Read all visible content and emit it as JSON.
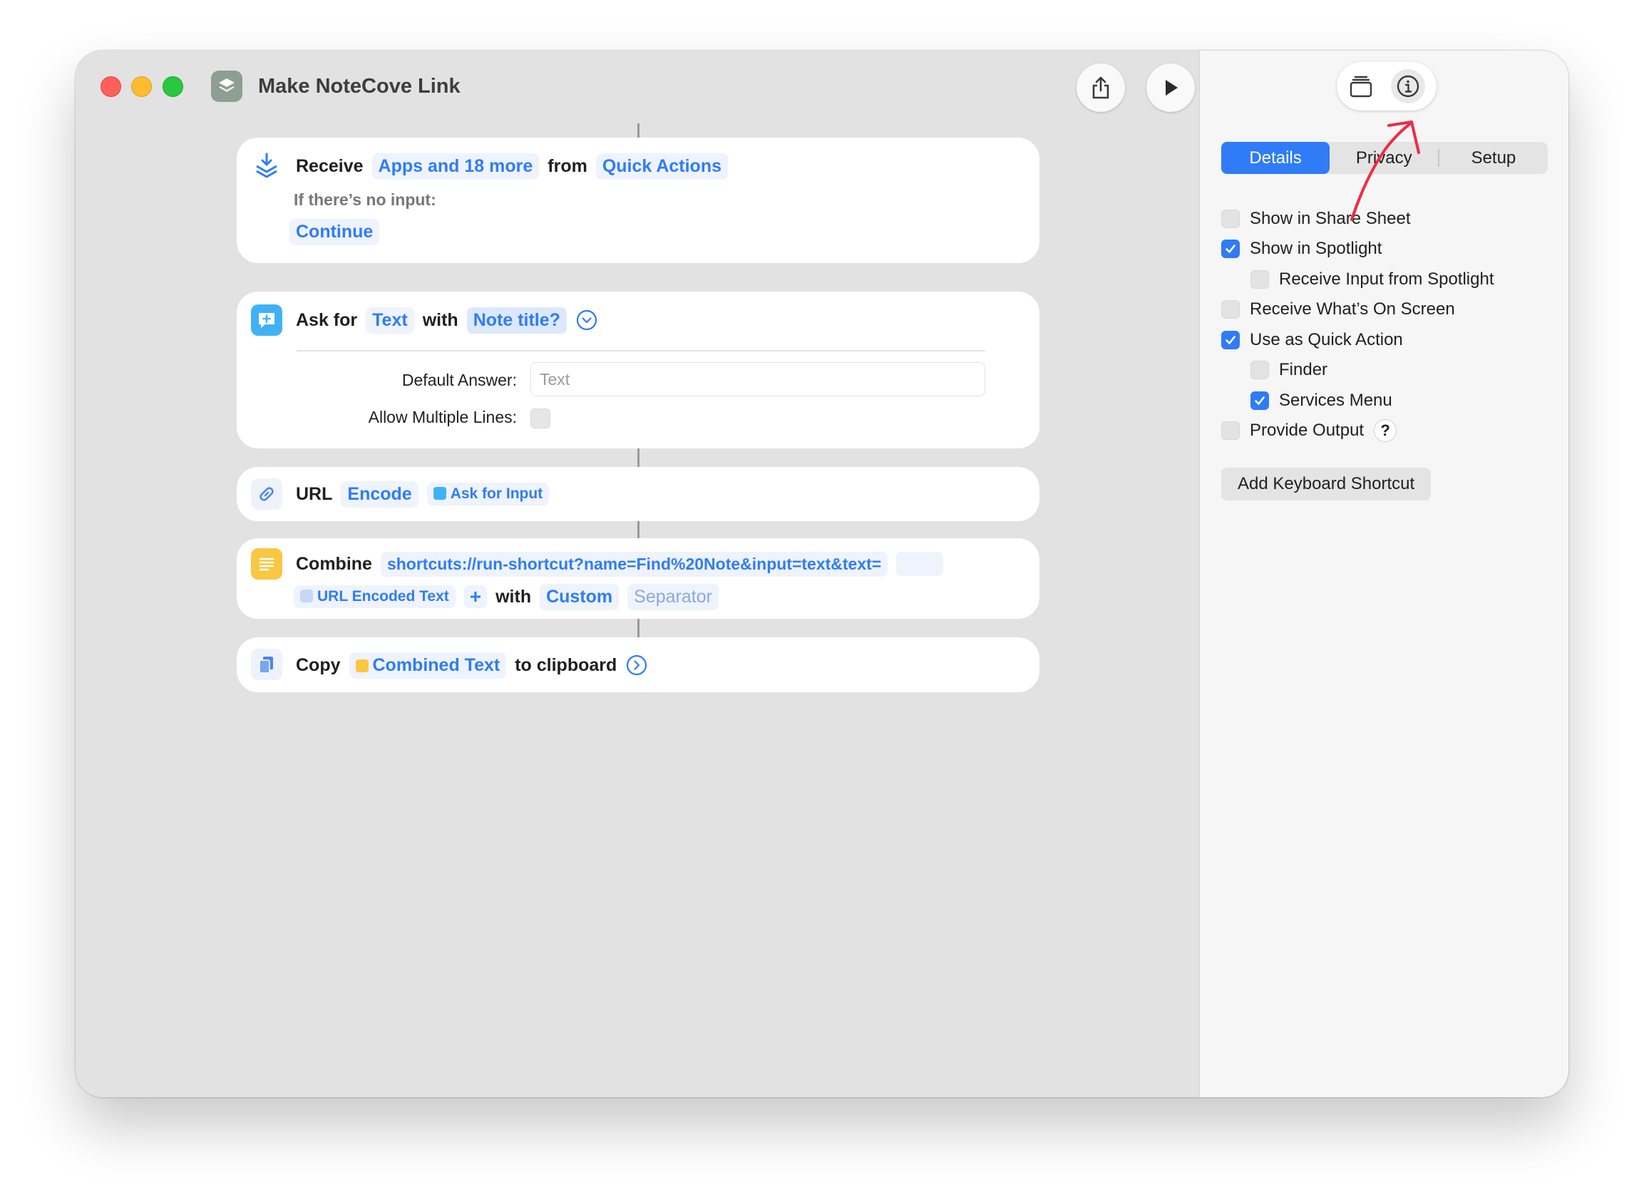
{
  "window": {
    "title": "Make NoteCove Link"
  },
  "toolbar": {
    "share_icon": "share-icon",
    "run_icon": "play-icon"
  },
  "actions": {
    "receive": {
      "label": "Receive",
      "types": "Apps and 18 more",
      "from_label": "from",
      "source": "Quick Actions",
      "no_input_label": "If there’s no input:",
      "no_input_action": "Continue"
    },
    "ask": {
      "label": "Ask for",
      "type": "Text",
      "with_label": "with",
      "prompt": "Note title?",
      "default_answer_label": "Default Answer:",
      "default_answer_placeholder": "Text",
      "allow_multiple_label": "Allow Multiple Lines:"
    },
    "url": {
      "label": "URL",
      "mode": "Encode",
      "input": "Ask for Input"
    },
    "combine": {
      "label": "Combine",
      "text": "shortcuts://run-shortcut?name=Find%20Note&input=text&text=",
      "variable": "URL Encoded Text",
      "add_symbol": "+",
      "with_label": "with",
      "separator_mode": "Custom",
      "separator_placeholder": "Separator"
    },
    "copy": {
      "label": "Copy",
      "variable": "Combined Text",
      "suffix": "to clipboard"
    }
  },
  "sidebar": {
    "tabs": [
      "Details",
      "Privacy",
      "Setup"
    ],
    "active_tab": "Details",
    "options": [
      {
        "label": "Show in Share Sheet",
        "checked": false
      },
      {
        "label": "Show in Spotlight",
        "checked": true
      },
      {
        "label": "Receive Input from Spotlight",
        "checked": false
      },
      {
        "label": "Receive What’s On Screen",
        "checked": false
      },
      {
        "label": "Use as Quick Action",
        "checked": true
      },
      {
        "label": "Finder",
        "checked": false
      },
      {
        "label": "Services Menu",
        "checked": true
      },
      {
        "label": "Provide Output",
        "checked": false
      }
    ],
    "help_symbol": "?",
    "shortcut_button": "Add Keyboard Shortcut"
  },
  "colors": {
    "accent": "#2f7cf6",
    "annotation": "#ef2b45",
    "window_bg": "#e2e2e2",
    "sidebar_bg": "#f6f6f6"
  }
}
